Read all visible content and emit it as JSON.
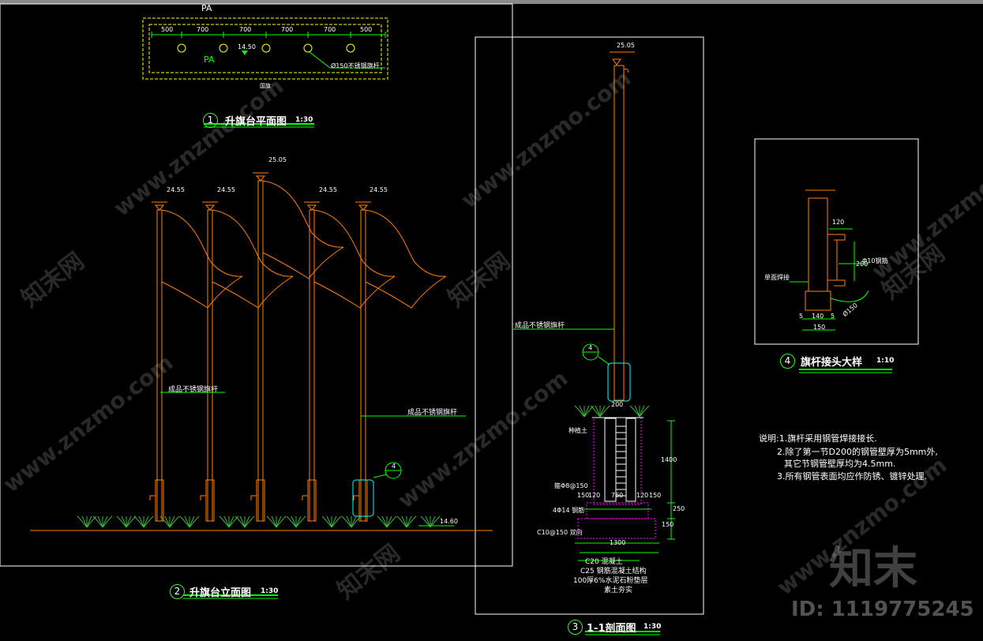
{
  "plan": {
    "pa_top": "PA",
    "pa_mid": "PA",
    "dims": [
      "500",
      "700",
      "700",
      "700",
      "700",
      "500"
    ],
    "center_elev": "14.50",
    "pole_spec": "Ø150不锈钢旗杆",
    "sub_label": "国旗",
    "num": "1",
    "title": "升旗台平面图",
    "scale": "1:30"
  },
  "elevation": {
    "tops": [
      "24.55",
      "24.55",
      "25.05",
      "24.55",
      "24.55"
    ],
    "label_left": "成品不锈钢旗杆",
    "label_right": "成品不锈钢旗杆",
    "ground_elev": "14.60",
    "detail_ref_top": "4",
    "detail_ref_bottom": "—",
    "num": "2",
    "title": "升旗台立面图",
    "scale": "1:30"
  },
  "section": {
    "top_elev": "25.05",
    "pole_label": "成品不锈钢旗杆",
    "detail_ref_top": "4",
    "detail_ref_bottom": "—",
    "pole_dia": "200",
    "left_notes": [
      "种植土",
      "箍Φ8@150",
      "4Φ14 钢筋",
      "C10@150 双向"
    ],
    "dims_h": [
      "150",
      "120",
      "760",
      "120",
      "150"
    ],
    "dims_v": [
      "1400",
      "250",
      "150"
    ],
    "base_width": "1300",
    "layers": [
      "C20 混凝土",
      "C25 钢筋混凝土结构",
      "100厚6%水泥石粉垫层",
      "素土夯实"
    ],
    "num": "3",
    "title": "1-1剖面图",
    "scale": "1:30"
  },
  "detail": {
    "labels": [
      "单面焊接",
      "Φ10钢筋"
    ],
    "dims": [
      "120",
      "200",
      "5",
      "140",
      "5",
      "150",
      "Ø150"
    ],
    "num": "4",
    "title": "旗杆接头大样",
    "scale": "1:10"
  },
  "notes": {
    "lines": [
      "说明:1.旗杆采用钢管焊接接长.",
      "2.除了第一节D200的钢管壁厚为5mm外,",
      "其它节钢管壁厚均为4.5mm.",
      "3.所有钢管表面均应作防锈、镀锌处理."
    ]
  },
  "watermark": {
    "text": "www.znzmo.com",
    "cn": "知末网",
    "brand": "知末",
    "id": "ID: 1119775245"
  },
  "colors": {
    "background": "#000000",
    "frame": "#ffffff",
    "pole": "#ff8000",
    "dashed_frame": "#ffff00",
    "leader": "#00ff00",
    "title_underline": "#00ff00",
    "detail_box": "#00ffff",
    "hatch": "#ff00ff",
    "plants": "#3cb43c"
  }
}
